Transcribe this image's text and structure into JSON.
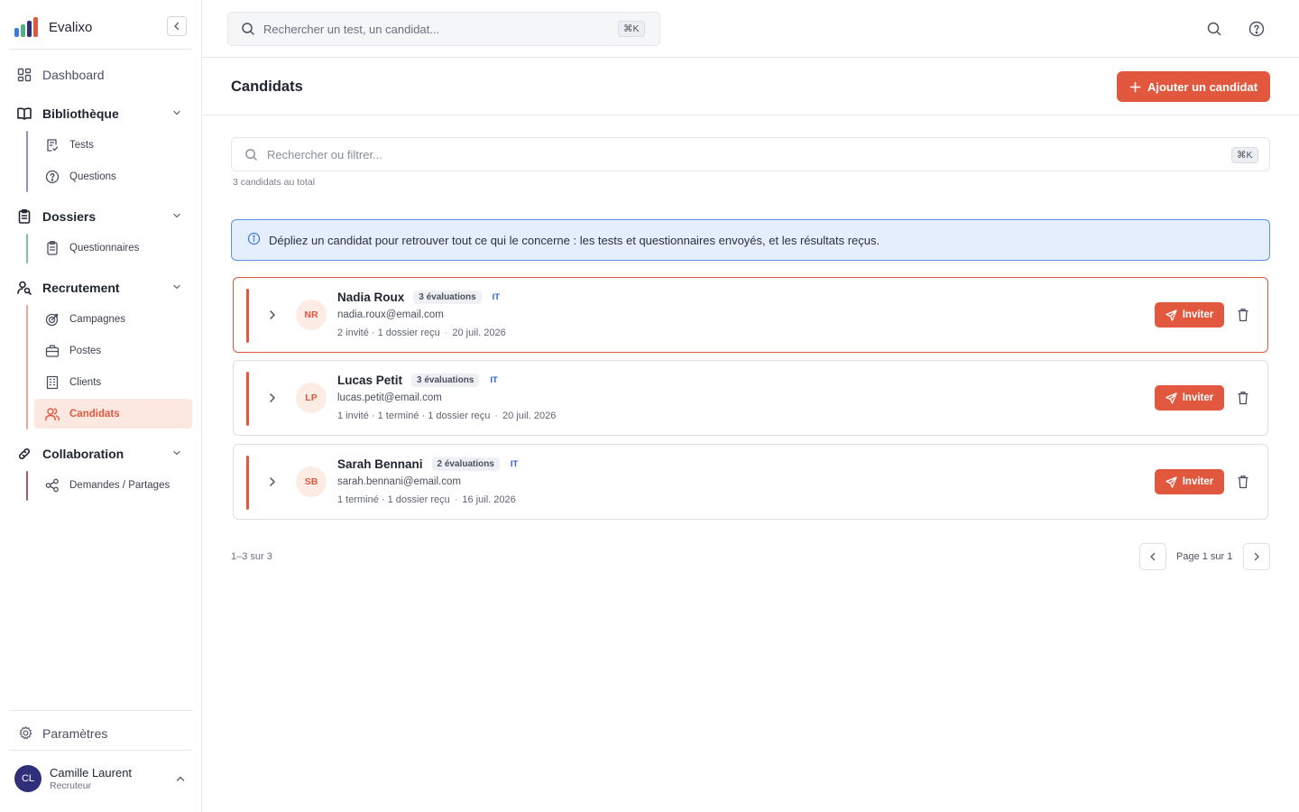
{
  "app": {
    "name": "Evalixo"
  },
  "colors": {
    "accent": "#e2583e",
    "info_bg": "#e4eefc",
    "info_border": "#5b8ef0",
    "tag_blue": "#2f5fd0"
  },
  "sidebar": {
    "dashboard": "Dashboard",
    "library": {
      "label": "Bibliothèque",
      "items": [
        "Tests",
        "Questions"
      ]
    },
    "folders": {
      "label": "Dossiers",
      "items": [
        "Questionnaires"
      ]
    },
    "recruitment": {
      "label": "Recrutement",
      "items": [
        "Campagnes",
        "Postes",
        "Clients",
        "Candidats"
      ],
      "active": "Candidats"
    },
    "collaboration": {
      "label": "Collaboration",
      "items": [
        "Demandes / Partages"
      ]
    },
    "settings": "Paramètres",
    "user": {
      "initials": "CL",
      "name": "Camille Laurent",
      "role": "Recruteur"
    }
  },
  "topbar": {
    "search_placeholder": "Rechercher un test, un candidat...",
    "shortcut": "⌘K"
  },
  "page": {
    "title": "Candidats",
    "add_button": "Ajouter un candidat",
    "filter_placeholder": "Rechercher ou filtrer...",
    "filter_shortcut": "⌘K",
    "total": "3 candidats au total",
    "info": "Dépliez un candidat pour retrouver tout ce qui le concerne : les tests et questionnaires envoyés, et les résultats reçus."
  },
  "candidates": [
    {
      "initials": "NR",
      "name": "Nadia Roux",
      "evaluations": "3 évaluations",
      "tag": "IT",
      "email": "nadia.roux@email.com",
      "status": "2 invité · 1 dossier reçu",
      "date": "20 juil. 2026",
      "invite": "Inviter",
      "selected": true
    },
    {
      "initials": "LP",
      "name": "Lucas Petit",
      "evaluations": "3 évaluations",
      "tag": "IT",
      "email": "lucas.petit@email.com",
      "status": "1 invité · 1 terminé · 1 dossier reçu",
      "date": "20 juil. 2026",
      "invite": "Inviter",
      "selected": false
    },
    {
      "initials": "SB",
      "name": "Sarah Bennani",
      "evaluations": "2 évaluations",
      "tag": "IT",
      "email": "sarah.bennani@email.com",
      "status": "1 terminé · 1 dossier reçu",
      "date": "16 juil. 2026",
      "invite": "Inviter",
      "selected": false
    }
  ],
  "pagination": {
    "range": "1–3 sur 3",
    "page": "Page 1 sur 1"
  }
}
